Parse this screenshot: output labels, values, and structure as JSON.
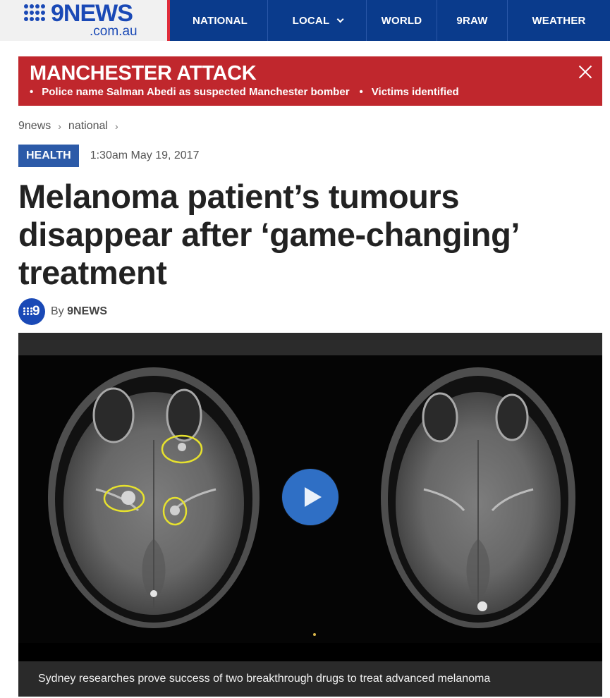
{
  "header": {
    "logo_text": "9NEWS",
    "logo_sub": ".com.au",
    "nav": [
      {
        "label": "NATIONAL",
        "has_dropdown": false
      },
      {
        "label": "LOCAL",
        "has_dropdown": true
      },
      {
        "label": "WORLD",
        "has_dropdown": false
      },
      {
        "label": "9RAW",
        "has_dropdown": false
      },
      {
        "label": "WEATHER",
        "has_dropdown": false
      }
    ]
  },
  "breaking": {
    "title": "MANCHESTER ATTACK",
    "links": [
      "Police name Salman Abedi as suspected Manchester bomber",
      "Victims identified"
    ],
    "bullet": "•",
    "close_icon": "close-icon"
  },
  "breadcrumb": {
    "items": [
      "9news",
      "national"
    ],
    "separator": "›"
  },
  "article": {
    "category": "HEALTH",
    "timestamp": "1:30am May 19, 2017",
    "headline": "Melanoma patient’s tumours disappear after ‘game-changing’ treatment",
    "byline_prefix": "By",
    "byline_author": "9NEWS",
    "author_avatar_text": "9"
  },
  "video": {
    "caption": "Sydney researches prove success of two breakthrough drugs to treat advanced melanoma",
    "play_icon": "play-icon"
  },
  "colors": {
    "nav_blue": "#0a3b8c",
    "logo_blue": "#1a49b6",
    "breaking_red": "#c0272d",
    "badge_blue": "#2c5aa8",
    "play_blue": "#2f6fc5",
    "highlight_yellow": "#e6e12e"
  }
}
